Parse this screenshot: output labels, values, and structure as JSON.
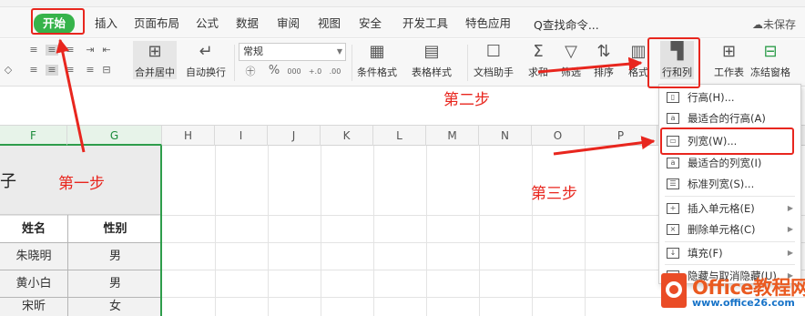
{
  "menu": {
    "tabs": [
      "开始",
      "插入",
      "页面布局",
      "公式",
      "数据",
      "审阅",
      "视图",
      "安全",
      "开发工具",
      "特色应用"
    ],
    "search": "Q查找命令...",
    "unsaved": "未保存"
  },
  "ribbon": {
    "merge_center": "合并居中",
    "auto_wrap": "自动换行",
    "number_format": "常规",
    "percent": "%",
    "thousands": "000",
    "cond_format": "条件格式",
    "table_style": "表格样式",
    "doc_assist": "文档助手",
    "sum": "求和",
    "filter": "筛选",
    "sort": "排序",
    "format": "格式",
    "row_col": "行和列",
    "worksheet": "工作表",
    "freeze": "冻结窗格"
  },
  "columns": [
    "F",
    "G",
    "H",
    "I",
    "J",
    "K",
    "L",
    "M",
    "N",
    "O",
    "P"
  ],
  "sheet": {
    "merged_partial_text": "子",
    "headers": [
      "姓名",
      "性别"
    ],
    "rows": [
      [
        "朱晓明",
        "男"
      ],
      [
        "黄小白",
        "男"
      ],
      [
        "宋昕",
        "女"
      ]
    ]
  },
  "dropdown": {
    "items": [
      "行高(H)...",
      "最适合的行高(A)",
      "列宽(W)...",
      "最适合的列宽(I)",
      "标准列宽(S)...",
      "插入单元格(E)",
      "删除单元格(C)",
      "填充(F)",
      "隐藏与取消隐藏(U)"
    ]
  },
  "annotations": {
    "step1": "第一步",
    "step2": "第二步",
    "step3": "第三步"
  },
  "watermark": {
    "title": "Office教程网",
    "url": "www.office26.com"
  },
  "colors": {
    "accent_green": "#36b34a",
    "annotation_red": "#e8261e",
    "watermark_orange": "#ea5a20",
    "watermark_blue": "#1773c8"
  }
}
